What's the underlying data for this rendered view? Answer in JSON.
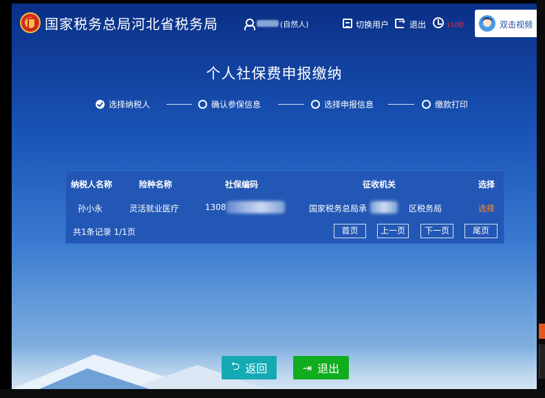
{
  "header": {
    "site_title": "国家税务总局河北省税务局",
    "user_type": "(自然人)",
    "switch_user": "切换用户",
    "logout": "退出",
    "timer": "110秒",
    "video_button": "双击视频"
  },
  "page": {
    "title": "个人社保费申报缴纳"
  },
  "steps": [
    {
      "label": "选择纳税人",
      "state": "done"
    },
    {
      "label": "确认参保信息",
      "state": "todo"
    },
    {
      "label": "选择申报信息",
      "state": "todo"
    },
    {
      "label": "缴款打印",
      "state": "todo"
    }
  ],
  "table": {
    "headers": [
      "纳税人名称",
      "险种名称",
      "社保编码",
      "征收机关",
      "选择"
    ],
    "rows": [
      {
        "name": "孙小永",
        "insurance": "灵活就业医疗",
        "code": "1308",
        "authority_prefix": "国家税务总局承",
        "authority_suffix": "区税务局",
        "select": "选择"
      }
    ],
    "summary": "共1条记录  1/1页",
    "pagination": {
      "first": "首页",
      "prev": "上一页",
      "next": "下一页",
      "last": "尾页"
    }
  },
  "actions": {
    "back": "返回",
    "exit": "退出"
  },
  "colors": {
    "accent_orange": "#ff8a1e",
    "timer_red": "#ff2a2a",
    "back_button": "#14a9b3",
    "exit_button": "#11ad1f",
    "panel": "#2357b5"
  }
}
